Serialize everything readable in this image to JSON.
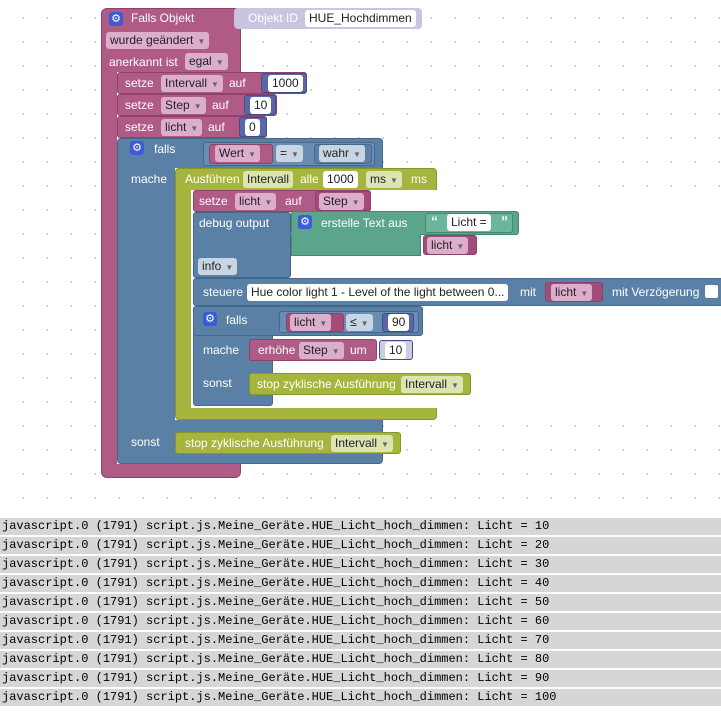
{
  "trigger": {
    "falls_objekt": "Falls Objekt",
    "objekt_id_label": "Objekt ID",
    "objekt_id_value": "HUE_Hochdimmen",
    "wurde": "wurde geändert",
    "anerkannt": "anerkannt ist",
    "egal": "egal"
  },
  "setze1": {
    "setze": "setze",
    "var": "Intervall",
    "auf": "auf",
    "value": "1000"
  },
  "setze2": {
    "setze": "setze",
    "var": "Step",
    "auf": "auf",
    "value": "10"
  },
  "setze3": {
    "setze": "setze",
    "var": "licht",
    "auf": "auf",
    "value": "0"
  },
  "if1": {
    "falls": "falls",
    "mache": "mache",
    "sonst": "sonst",
    "cond_left": "Wert",
    "cond_op": "=",
    "cond_right": "wahr"
  },
  "interval": {
    "ausfuehren": "Ausführen",
    "var": "Intervall",
    "alle": "alle",
    "value": "1000",
    "unit": "ms",
    "ms": "ms"
  },
  "setze4": {
    "setze": "setze",
    "var": "licht",
    "auf": "auf",
    "value": "Step"
  },
  "debug": {
    "label": "debug output",
    "erstelle": "erstelle Text aus",
    "text": "Licht = ",
    "var": "licht",
    "level": "info"
  },
  "steuere": {
    "label": "steuere",
    "device": "Hue color light 1 - Level of the light between 0...",
    "mit": "mit",
    "var": "licht",
    "verzoegerung": "mit Verzögerung"
  },
  "if2": {
    "falls": "falls",
    "mache": "mache",
    "sonst": "sonst",
    "cond_left": "licht",
    "cond_op": "≤",
    "cond_right": "90",
    "erhoehe": "erhöhe",
    "erhoehe_var": "Step",
    "um": "um",
    "um_value": "10",
    "stop_label": "stop zyklische Ausführung",
    "stop_var": "Intervall"
  },
  "stop_outer": {
    "label": "stop zyklische Ausführung",
    "var": "Intervall"
  },
  "console": {
    "lines": [
      "javascript.0 (1791) script.js.Meine_Geräte.HUE_Licht_hoch_dimmen: Licht = 10",
      "javascript.0 (1791) script.js.Meine_Geräte.HUE_Licht_hoch_dimmen: Licht = 20",
      "javascript.0 (1791) script.js.Meine_Geräte.HUE_Licht_hoch_dimmen: Licht = 30",
      "javascript.0 (1791) script.js.Meine_Geräte.HUE_Licht_hoch_dimmen: Licht = 40",
      "javascript.0 (1791) script.js.Meine_Geräte.HUE_Licht_hoch_dimmen: Licht = 50",
      "javascript.0 (1791) script.js.Meine_Geräte.HUE_Licht_hoch_dimmen: Licht = 60",
      "javascript.0 (1791) script.js.Meine_Geräte.HUE_Licht_hoch_dimmen: Licht = 70",
      "javascript.0 (1791) script.js.Meine_Geräte.HUE_Licht_hoch_dimmen: Licht = 80",
      "javascript.0 (1791) script.js.Meine_Geräte.HUE_Licht_hoch_dimmen: Licht = 90",
      "javascript.0 (1791) script.js.Meine_Geräte.HUE_Licht_hoch_dimmen: Licht = 100"
    ]
  }
}
